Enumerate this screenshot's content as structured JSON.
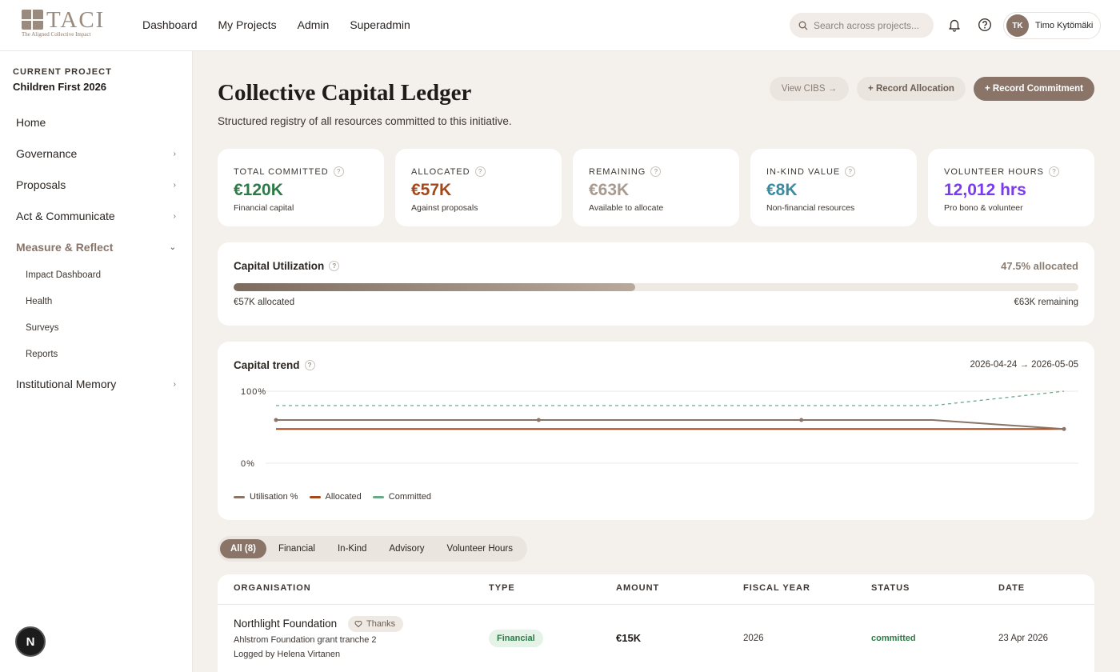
{
  "brand": {
    "name": "TACI",
    "tagline": "The Aligned Collective Impact"
  },
  "topnav": [
    "Dashboard",
    "My Projects",
    "Admin",
    "Superadmin"
  ],
  "search": {
    "placeholder": "Search across projects..."
  },
  "user": {
    "initials": "TK",
    "name": "Timo Kytömäki"
  },
  "sidebar": {
    "current_label": "CURRENT PROJECT",
    "current_name": "Children First 2026",
    "items": [
      "Home",
      "Governance",
      "Proposals",
      "Act & Communicate",
      "Measure & Reflect",
      "Institutional Memory"
    ],
    "sub_items": [
      "Impact Dashboard",
      "Health",
      "Surveys",
      "Reports"
    ],
    "bottom_badge": "N"
  },
  "page": {
    "title": "Collective Capital Ledger",
    "subtitle": "Structured registry of all resources committed to this initiative.",
    "buttons": {
      "view_cibs": "View CIBS →",
      "record_allocation": "+ Record Allocation",
      "record_commitment": "+ Record Commitment"
    }
  },
  "kpis": [
    {
      "label": "TOTAL COMMITTED",
      "value": "€120K",
      "note": "Financial capital",
      "color": "#2c7a45"
    },
    {
      "label": "ALLOCATED",
      "value": "€57K",
      "note": "Against proposals",
      "color": "#a4481b"
    },
    {
      "label": "REMAINING",
      "value": "€63K",
      "note": "Available to allocate",
      "color": "#a89a8e"
    },
    {
      "label": "IN-KIND VALUE",
      "value": "€8K",
      "note": "Non-financial resources",
      "color": "#3b8aa0"
    },
    {
      "label": "VOLUNTEER HOURS",
      "value": "12,012 hrs",
      "note": "Pro bono & volunteer",
      "color": "#7c3aed"
    }
  ],
  "utilization": {
    "title": "Capital Utilization",
    "pct_label": "47.5% allocated",
    "fraction": 0.475,
    "allocated_label": "€57K allocated",
    "remaining_label": "€63K remaining"
  },
  "trend": {
    "title": "Capital trend",
    "range": "2026-04-24 → 2026-05-05"
  },
  "chart_data": {
    "type": "line",
    "y_ticks": [
      "100%",
      "0%"
    ],
    "ylim": [
      0,
      100
    ],
    "x_points": 7,
    "series": [
      {
        "name": "Utilisation %",
        "color": "#8a7468",
        "values": [
          60,
          60,
          60,
          60,
          60,
          60,
          47.5
        ],
        "markers": true
      },
      {
        "name": "Allocated",
        "color": "#a4481b",
        "values": [
          47.5,
          47.5,
          47.5,
          47.5,
          47.5,
          47.5,
          47.5
        ],
        "markers": false
      },
      {
        "name": "Committed",
        "color": "#6aa88a",
        "values": [
          80,
          80,
          80,
          80,
          80,
          80,
          100
        ],
        "markers": false,
        "dashed": true
      }
    ],
    "grid": true,
    "legend": "bottom-left"
  },
  "tabs": [
    "All (8)",
    "Financial",
    "In-Kind",
    "Advisory",
    "Volunteer Hours"
  ],
  "table": {
    "headers": [
      "ORGANISATION",
      "TYPE",
      "AMOUNT",
      "FISCAL YEAR",
      "STATUS",
      "DATE"
    ],
    "rows": [
      {
        "org": "Northlight Foundation",
        "thanks": "Thanks",
        "desc": "Ahlstrom Foundation grant tranche 2",
        "logged": "Logged by Helena Virtanen",
        "type": "Financial",
        "amount": "€15K",
        "fiscal_year": "2026",
        "status": "committed",
        "date": "23 Apr 2026"
      }
    ]
  }
}
